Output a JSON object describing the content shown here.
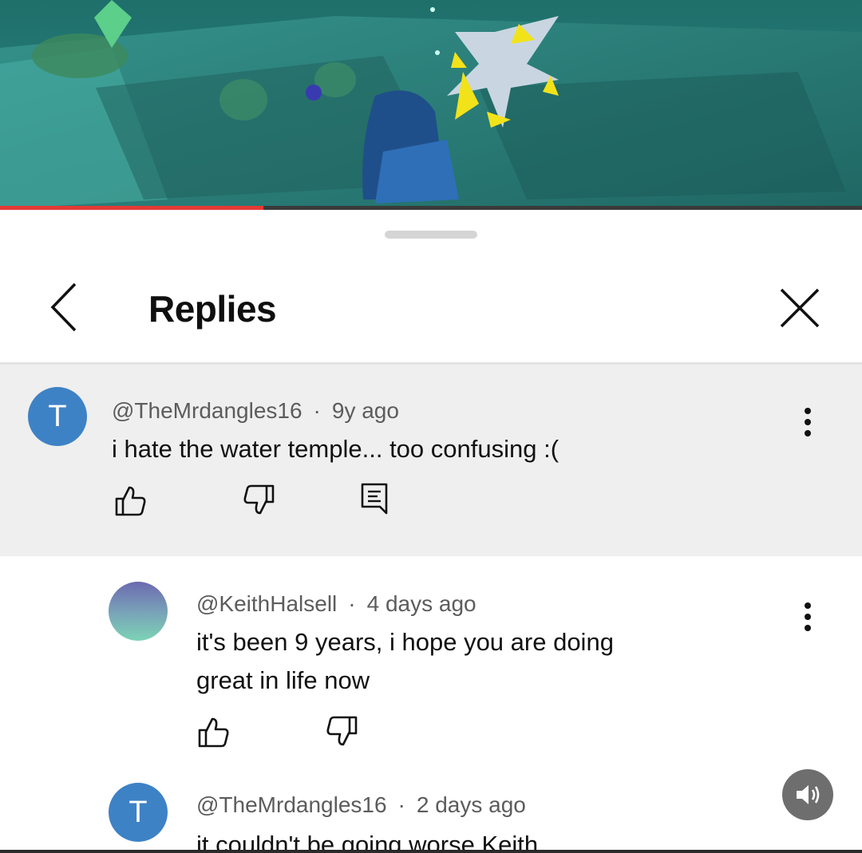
{
  "video": {
    "progress": 0.306
  },
  "header": {
    "title": "Replies"
  },
  "comments": [
    {
      "avatar_letter": "T",
      "avatar_color": "#3e82c6",
      "handle": "@TheMrdangles16",
      "time": "9y ago",
      "text": "i hate the water temple... too confusing :("
    },
    {
      "avatar_letter": "",
      "handle": "@KeithHalsell",
      "time": "4 days ago",
      "text": "it's been 9 years, i hope you are doing great in life now"
    },
    {
      "avatar_letter": "T",
      "avatar_color": "#3e82c6",
      "handle": "@TheMrdangles16",
      "time": "2 days ago",
      "text": "it couldn't be going worse Keith"
    }
  ],
  "icons": {
    "back": "chevron-left-icon",
    "close": "close-icon",
    "like": "thumbs-up-icon",
    "dislike": "thumbs-down-icon",
    "reply": "reply-comment-icon",
    "more": "more-vertical-icon",
    "sound": "speaker-icon"
  },
  "colors": {
    "progress": "#e53935",
    "parent_bg": "#efefef",
    "avatar_blue": "#3e82c6"
  }
}
